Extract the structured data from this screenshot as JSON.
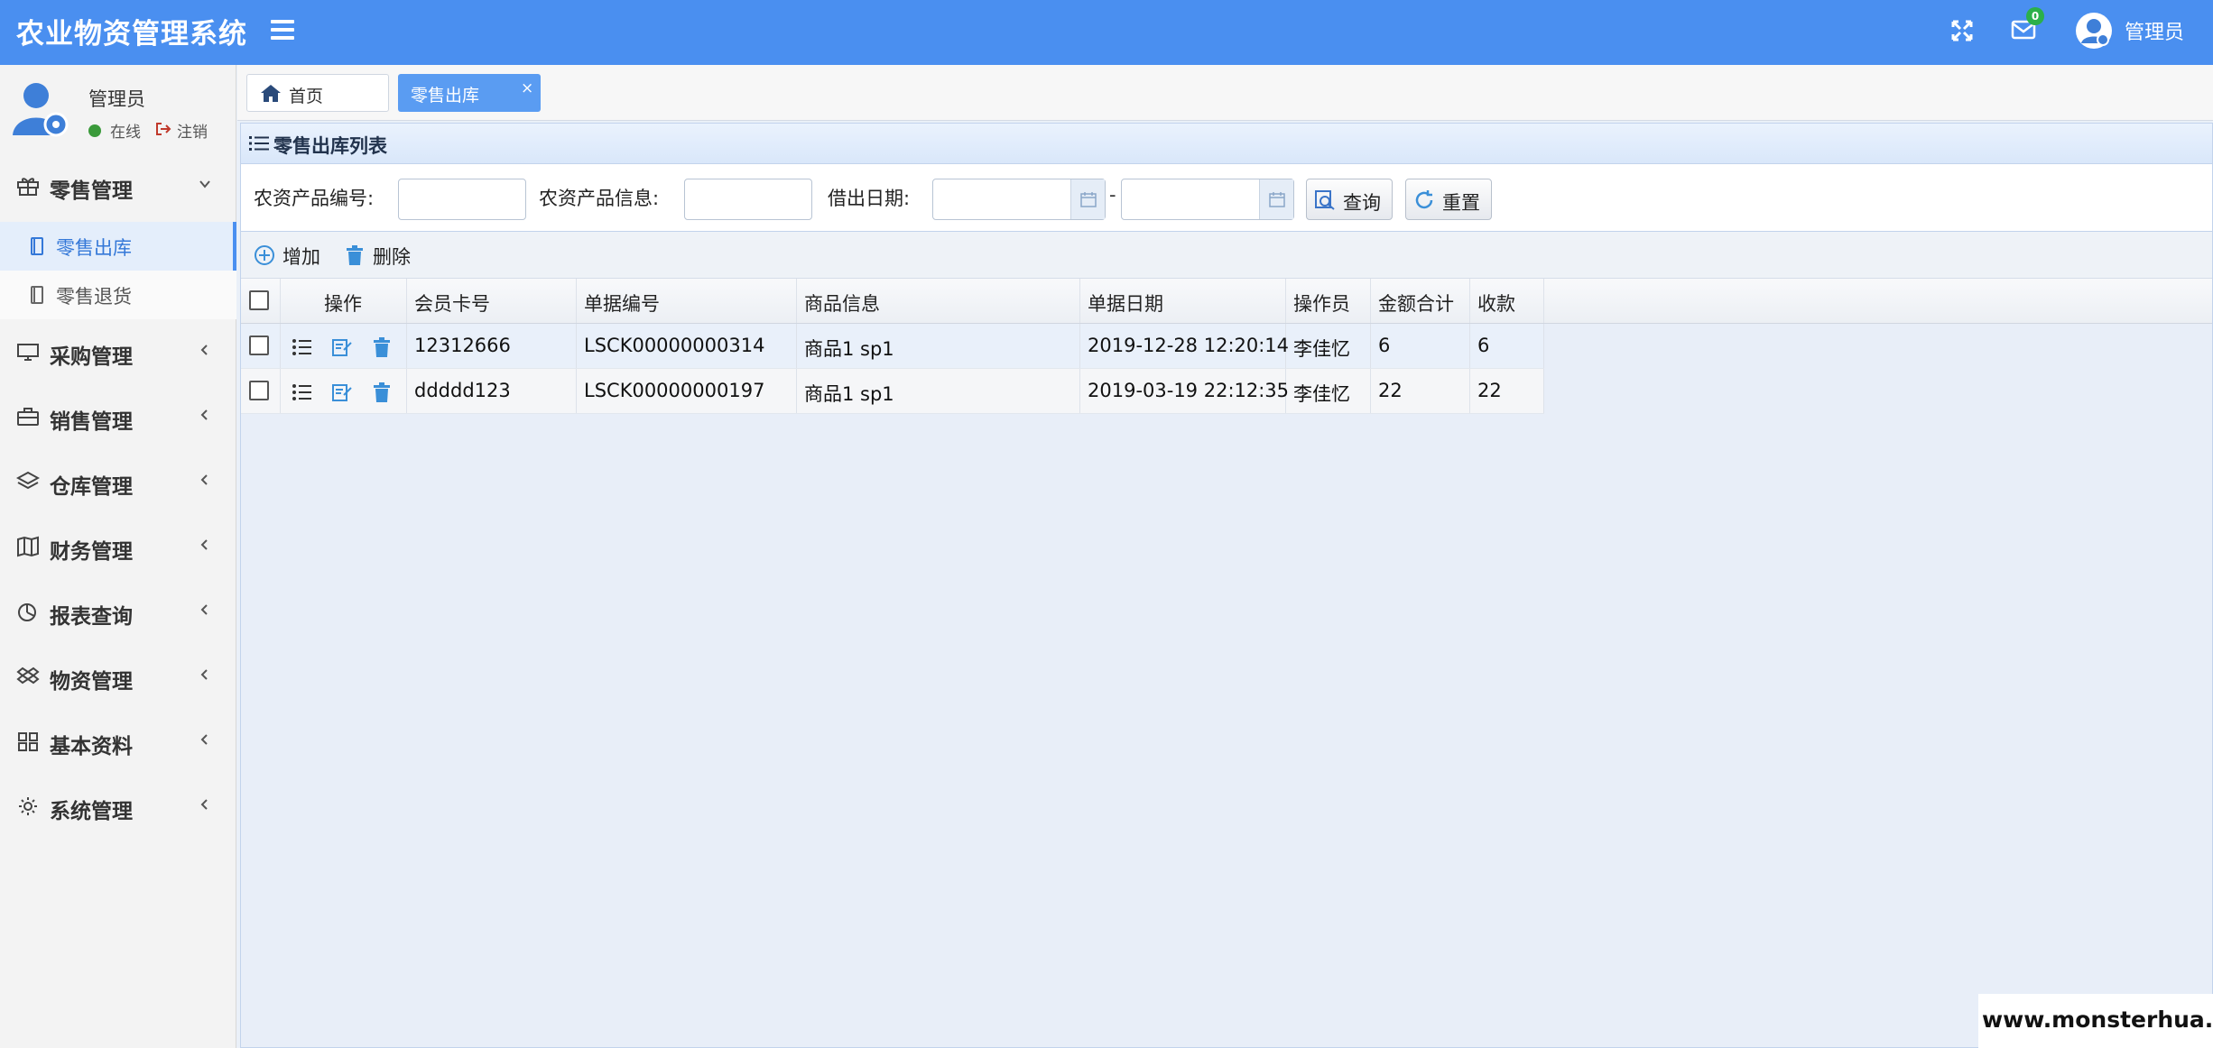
{
  "header": {
    "app_title": "农业物资管理系统",
    "mail_count": "0",
    "user_name": "管理员",
    "colors": {
      "bar": "#4a8ff0",
      "badge": "#2bb04a"
    }
  },
  "sidebar": {
    "user": {
      "name": "管理员",
      "status": "在线",
      "logout": "注销"
    },
    "groups": [
      {
        "label": "零售管理",
        "icon": "gift-icon",
        "expanded": true,
        "items": [
          {
            "label": "零售出库",
            "active": true
          },
          {
            "label": "零售退货",
            "active": false
          }
        ]
      },
      {
        "label": "采购管理",
        "icon": "monitor-icon"
      },
      {
        "label": "销售管理",
        "icon": "briefcase-icon"
      },
      {
        "label": "仓库管理",
        "icon": "layers-icon"
      },
      {
        "label": "财务管理",
        "icon": "map-icon"
      },
      {
        "label": "报表查询",
        "icon": "pie-chart-icon"
      },
      {
        "label": "物资管理",
        "icon": "dropbox-icon"
      },
      {
        "label": "基本资料",
        "icon": "grid-icon"
      },
      {
        "label": "系统管理",
        "icon": "gear-icon"
      }
    ]
  },
  "tabs": {
    "home": "首页",
    "active": "零售出库",
    "close": "×"
  },
  "panel": {
    "title": "零售出库列表"
  },
  "search": {
    "product_code_label": "农资产品编号:",
    "product_code_value": "",
    "product_info_label": "农资产品信息:",
    "product_info_value": "",
    "date_label": "借出日期:",
    "date_from": "",
    "date_to": "",
    "date_separator": "-",
    "query_button": "查询",
    "reset_button": "重置"
  },
  "toolbar": {
    "add": "增加",
    "delete": "删除"
  },
  "table": {
    "columns": [
      "操作",
      "会员卡号",
      "单据编号",
      "商品信息",
      "单据日期",
      "操作员",
      "金额合计",
      "收款"
    ],
    "rows": [
      {
        "member_card": "12312666",
        "doc_no": "LSCK00000000314",
        "product": "商品1 sp1",
        "date": "2019-12-28 12:20:14",
        "operator": "李佳忆",
        "total": "6",
        "received": "6"
      },
      {
        "member_card": "ddddd123",
        "doc_no": "LSCK00000000197",
        "product": "商品1 sp1",
        "date": "2019-03-19 22:12:35",
        "operator": "李佳忆",
        "total": "22",
        "received": "22"
      }
    ]
  },
  "watermark": "www.monsterhua.com"
}
